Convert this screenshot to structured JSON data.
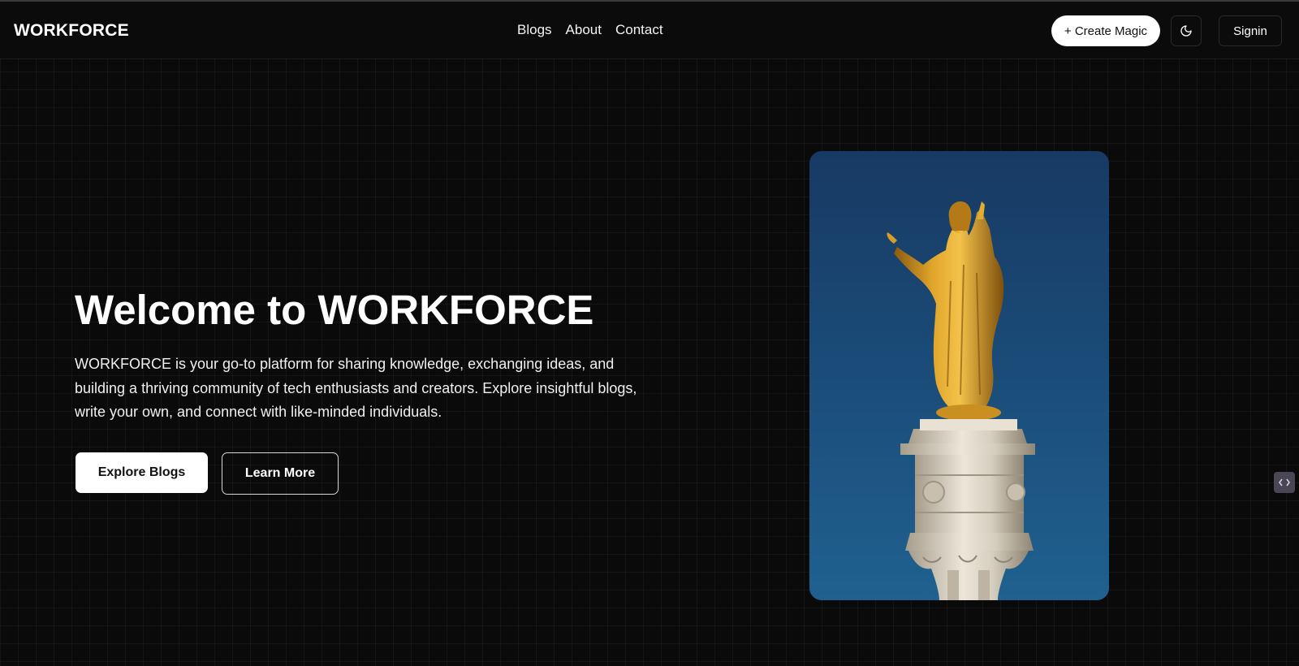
{
  "header": {
    "logo": "WORKFORCE",
    "nav": [
      {
        "label": "Blogs"
      },
      {
        "label": "About"
      },
      {
        "label": "Contact"
      }
    ],
    "create_label": "+ Create Magic",
    "theme_icon": "moon-icon",
    "signin_label": "Signin"
  },
  "hero": {
    "title": "Welcome to WORKFORCE",
    "description": "WORKFORCE is your go-to platform for sharing knowledge, exchanging ideas, and building a thriving community of tech enthusiasts and creators. Explore insightful blogs, write your own, and connect with like-minded individuals.",
    "explore_label": "Explore Blogs",
    "learn_label": "Learn More",
    "image_subject": "golden-statue-on-pillar-image"
  },
  "colors": {
    "background": "#0a0a0b",
    "primary_button": "#ffffff",
    "sky": "#1d4f7c",
    "statue_gold": "#d49a22",
    "pillar_stone": "#d8cfbf"
  }
}
